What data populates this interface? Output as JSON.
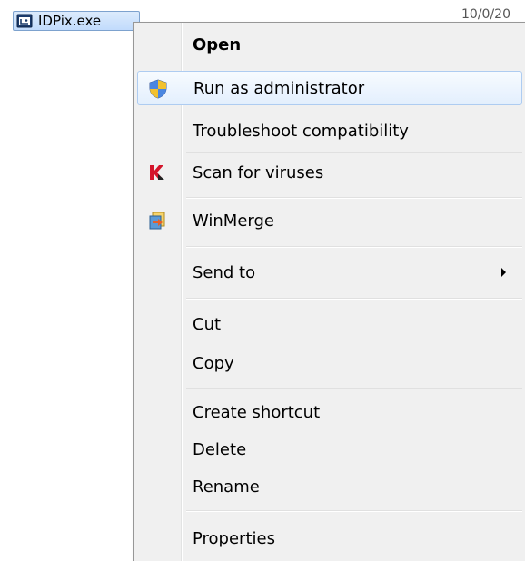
{
  "file": {
    "name": "IDPix.exe",
    "date": "10/0/20",
    "icon": "app-window-icon"
  },
  "menu": {
    "items": [
      {
        "label": "Open",
        "bold": true
      },
      {
        "label": "Run as administrator",
        "icon": "uac-shield-icon",
        "highlighted": true
      },
      {
        "label": "Troubleshoot compatibility"
      },
      {
        "label": "Scan for viruses",
        "icon": "antivirus-icon"
      },
      {
        "label": "WinMerge",
        "icon": "winmerge-icon"
      },
      {
        "label": "Send to",
        "submenu": true
      },
      {
        "label": "Cut"
      },
      {
        "label": "Copy"
      },
      {
        "label": "Create shortcut"
      },
      {
        "label": "Delete"
      },
      {
        "label": "Rename"
      },
      {
        "label": "Properties"
      }
    ]
  },
  "colors": {
    "highlight_border": "#aeccf1",
    "menu_background": "#f0f0f0",
    "selection_background": "#c1dbfc"
  }
}
